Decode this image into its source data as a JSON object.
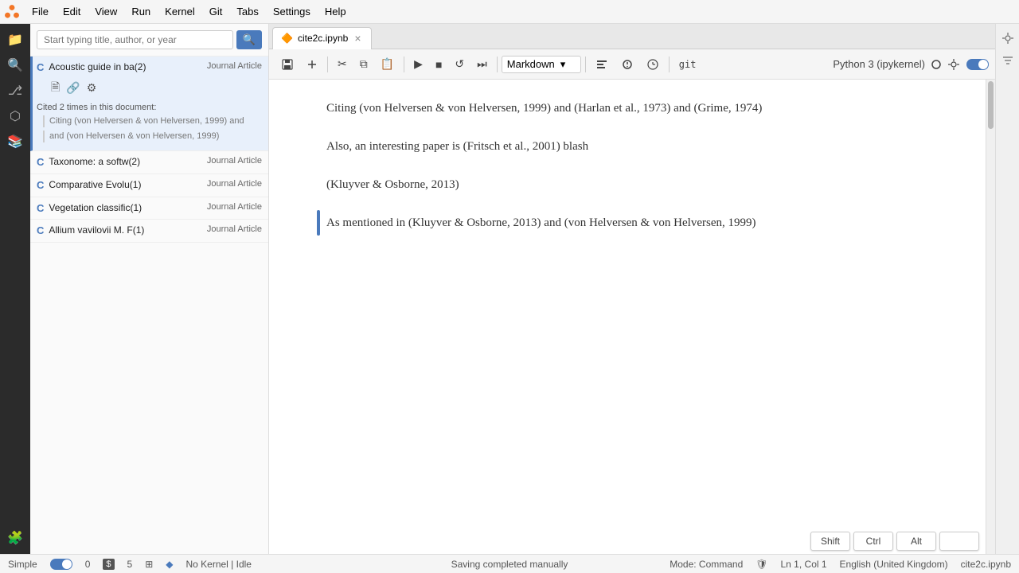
{
  "app": {
    "menu_items": [
      "File",
      "Edit",
      "View",
      "Run",
      "Kernel",
      "Git",
      "Tabs",
      "Settings",
      "Help"
    ]
  },
  "icon_sidebar": {
    "icons": [
      {
        "name": "folder-icon",
        "glyph": "📁"
      },
      {
        "name": "search-sidebar-icon",
        "glyph": "🔍"
      },
      {
        "name": "git-icon",
        "glyph": "⎇"
      },
      {
        "name": "extensions-icon",
        "glyph": "🔧"
      },
      {
        "name": "book-icon",
        "glyph": "📚"
      },
      {
        "name": "puzzle-icon",
        "glyph": "🧩"
      }
    ]
  },
  "citation_panel": {
    "search_placeholder": "Start typing title, author, or year",
    "items": [
      {
        "letter": "C",
        "title": "Acoustic guide in ba(2)",
        "type": "Journal Article",
        "expanded": true,
        "cited_count": "Cited 2 times in this document:",
        "actions": [
          "file-icon",
          "link-icon",
          "gear-icon"
        ],
        "contexts": [
          "Citing (von Helversen & von Helversen, 1999) and",
          "and (von Helversen & von Helversen, 1999)"
        ]
      },
      {
        "letter": "C",
        "title": "Taxonome: a softw(2)",
        "type": "Journal Article",
        "expanded": false
      },
      {
        "letter": "C",
        "title": "Comparative Evolu(1)",
        "type": "Journal Article",
        "expanded": false
      },
      {
        "letter": "C",
        "title": "Vegetation classific(1)",
        "type": "Journal Article",
        "expanded": false
      },
      {
        "letter": "C",
        "title": "Allium vavilovii M. F(1)",
        "type": "Journal Article",
        "expanded": false
      }
    ]
  },
  "tab": {
    "label": "cite2c.ipynb",
    "close": "×"
  },
  "toolbar": {
    "save_label": "💾",
    "add_label": "+",
    "cut_label": "✂",
    "copy_label": "⧉",
    "paste_label": "📋",
    "run_label": "▶",
    "stop_label": "■",
    "restart_label": "↺",
    "restart_run_label": "⏭",
    "cell_type": "Markdown",
    "commit_label": "git",
    "kernel_status": "Python 3 (ipykernel)",
    "kernel_dot": "○"
  },
  "cells": [
    {
      "id": 1,
      "active": false,
      "indicator": false,
      "text": "Citing (von Helversen & von Helversen, 1999) and (Harlan et al., 1973) and (Grime, 1974)"
    },
    {
      "id": 2,
      "active": false,
      "indicator": false,
      "text": "Also, an interesting paper is (Fritsch et al., 2001) blash"
    },
    {
      "id": 3,
      "active": false,
      "indicator": false,
      "text": "(Kluyver & Osborne, 2013)"
    },
    {
      "id": 4,
      "active": true,
      "indicator": true,
      "text": "As mentioned in (Kluyver & Osborne, 2013) and (von Helversen & von Helversen, 1999)"
    }
  ],
  "status_bar": {
    "simple_label": "Simple",
    "zero_label": "0",
    "five_label": "5",
    "no_kernel": "No Kernel | Idle",
    "saving": "Saving completed manually",
    "mode": "Mode: Command",
    "ln_col": "Ln 1, Col 1",
    "language": "English (United Kingdom)",
    "filename": "cite2c.ipynb"
  },
  "keyboard_hints": {
    "shift_label": "Shift",
    "ctrl_label": "Ctrl",
    "alt_label": "Alt",
    "blank_label": ""
  }
}
